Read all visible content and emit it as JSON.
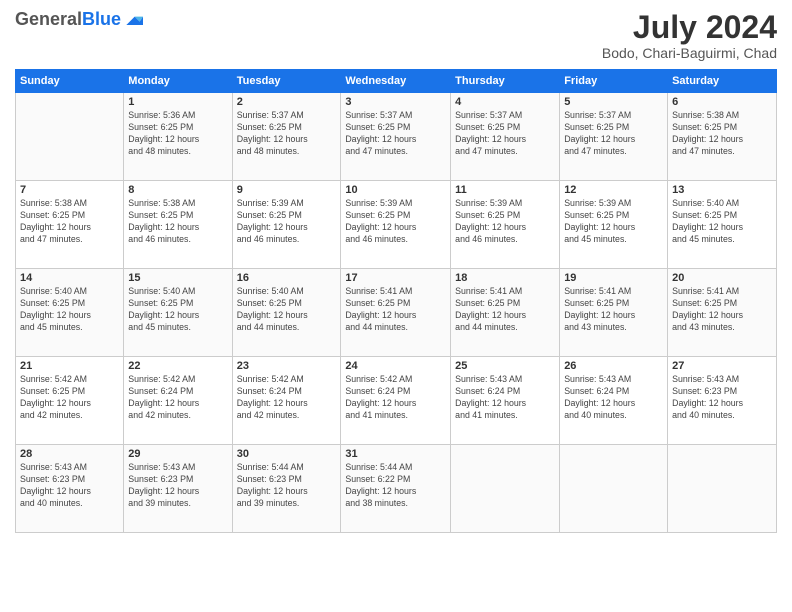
{
  "logo": {
    "general": "General",
    "blue": "Blue"
  },
  "header": {
    "month": "July 2024",
    "location": "Bodo, Chari-Baguirmi, Chad"
  },
  "weekdays": [
    "Sunday",
    "Monday",
    "Tuesday",
    "Wednesday",
    "Thursday",
    "Friday",
    "Saturday"
  ],
  "weeks": [
    [
      {
        "day": "",
        "info": ""
      },
      {
        "day": "1",
        "info": "Sunrise: 5:36 AM\nSunset: 6:25 PM\nDaylight: 12 hours\nand 48 minutes."
      },
      {
        "day": "2",
        "info": "Sunrise: 5:37 AM\nSunset: 6:25 PM\nDaylight: 12 hours\nand 48 minutes."
      },
      {
        "day": "3",
        "info": "Sunrise: 5:37 AM\nSunset: 6:25 PM\nDaylight: 12 hours\nand 47 minutes."
      },
      {
        "day": "4",
        "info": "Sunrise: 5:37 AM\nSunset: 6:25 PM\nDaylight: 12 hours\nand 47 minutes."
      },
      {
        "day": "5",
        "info": "Sunrise: 5:37 AM\nSunset: 6:25 PM\nDaylight: 12 hours\nand 47 minutes."
      },
      {
        "day": "6",
        "info": "Sunrise: 5:38 AM\nSunset: 6:25 PM\nDaylight: 12 hours\nand 47 minutes."
      }
    ],
    [
      {
        "day": "7",
        "info": "Sunrise: 5:38 AM\nSunset: 6:25 PM\nDaylight: 12 hours\nand 47 minutes."
      },
      {
        "day": "8",
        "info": "Sunrise: 5:38 AM\nSunset: 6:25 PM\nDaylight: 12 hours\nand 46 minutes."
      },
      {
        "day": "9",
        "info": "Sunrise: 5:39 AM\nSunset: 6:25 PM\nDaylight: 12 hours\nand 46 minutes."
      },
      {
        "day": "10",
        "info": "Sunrise: 5:39 AM\nSunset: 6:25 PM\nDaylight: 12 hours\nand 46 minutes."
      },
      {
        "day": "11",
        "info": "Sunrise: 5:39 AM\nSunset: 6:25 PM\nDaylight: 12 hours\nand 46 minutes."
      },
      {
        "day": "12",
        "info": "Sunrise: 5:39 AM\nSunset: 6:25 PM\nDaylight: 12 hours\nand 45 minutes."
      },
      {
        "day": "13",
        "info": "Sunrise: 5:40 AM\nSunset: 6:25 PM\nDaylight: 12 hours\nand 45 minutes."
      }
    ],
    [
      {
        "day": "14",
        "info": "Sunrise: 5:40 AM\nSunset: 6:25 PM\nDaylight: 12 hours\nand 45 minutes."
      },
      {
        "day": "15",
        "info": "Sunrise: 5:40 AM\nSunset: 6:25 PM\nDaylight: 12 hours\nand 45 minutes."
      },
      {
        "day": "16",
        "info": "Sunrise: 5:40 AM\nSunset: 6:25 PM\nDaylight: 12 hours\nand 44 minutes."
      },
      {
        "day": "17",
        "info": "Sunrise: 5:41 AM\nSunset: 6:25 PM\nDaylight: 12 hours\nand 44 minutes."
      },
      {
        "day": "18",
        "info": "Sunrise: 5:41 AM\nSunset: 6:25 PM\nDaylight: 12 hours\nand 44 minutes."
      },
      {
        "day": "19",
        "info": "Sunrise: 5:41 AM\nSunset: 6:25 PM\nDaylight: 12 hours\nand 43 minutes."
      },
      {
        "day": "20",
        "info": "Sunrise: 5:41 AM\nSunset: 6:25 PM\nDaylight: 12 hours\nand 43 minutes."
      }
    ],
    [
      {
        "day": "21",
        "info": "Sunrise: 5:42 AM\nSunset: 6:25 PM\nDaylight: 12 hours\nand 42 minutes."
      },
      {
        "day": "22",
        "info": "Sunrise: 5:42 AM\nSunset: 6:24 PM\nDaylight: 12 hours\nand 42 minutes."
      },
      {
        "day": "23",
        "info": "Sunrise: 5:42 AM\nSunset: 6:24 PM\nDaylight: 12 hours\nand 42 minutes."
      },
      {
        "day": "24",
        "info": "Sunrise: 5:42 AM\nSunset: 6:24 PM\nDaylight: 12 hours\nand 41 minutes."
      },
      {
        "day": "25",
        "info": "Sunrise: 5:43 AM\nSunset: 6:24 PM\nDaylight: 12 hours\nand 41 minutes."
      },
      {
        "day": "26",
        "info": "Sunrise: 5:43 AM\nSunset: 6:24 PM\nDaylight: 12 hours\nand 40 minutes."
      },
      {
        "day": "27",
        "info": "Sunrise: 5:43 AM\nSunset: 6:23 PM\nDaylight: 12 hours\nand 40 minutes."
      }
    ],
    [
      {
        "day": "28",
        "info": "Sunrise: 5:43 AM\nSunset: 6:23 PM\nDaylight: 12 hours\nand 40 minutes."
      },
      {
        "day": "29",
        "info": "Sunrise: 5:43 AM\nSunset: 6:23 PM\nDaylight: 12 hours\nand 39 minutes."
      },
      {
        "day": "30",
        "info": "Sunrise: 5:44 AM\nSunset: 6:23 PM\nDaylight: 12 hours\nand 39 minutes."
      },
      {
        "day": "31",
        "info": "Sunrise: 5:44 AM\nSunset: 6:22 PM\nDaylight: 12 hours\nand 38 minutes."
      },
      {
        "day": "",
        "info": ""
      },
      {
        "day": "",
        "info": ""
      },
      {
        "day": "",
        "info": ""
      }
    ]
  ]
}
